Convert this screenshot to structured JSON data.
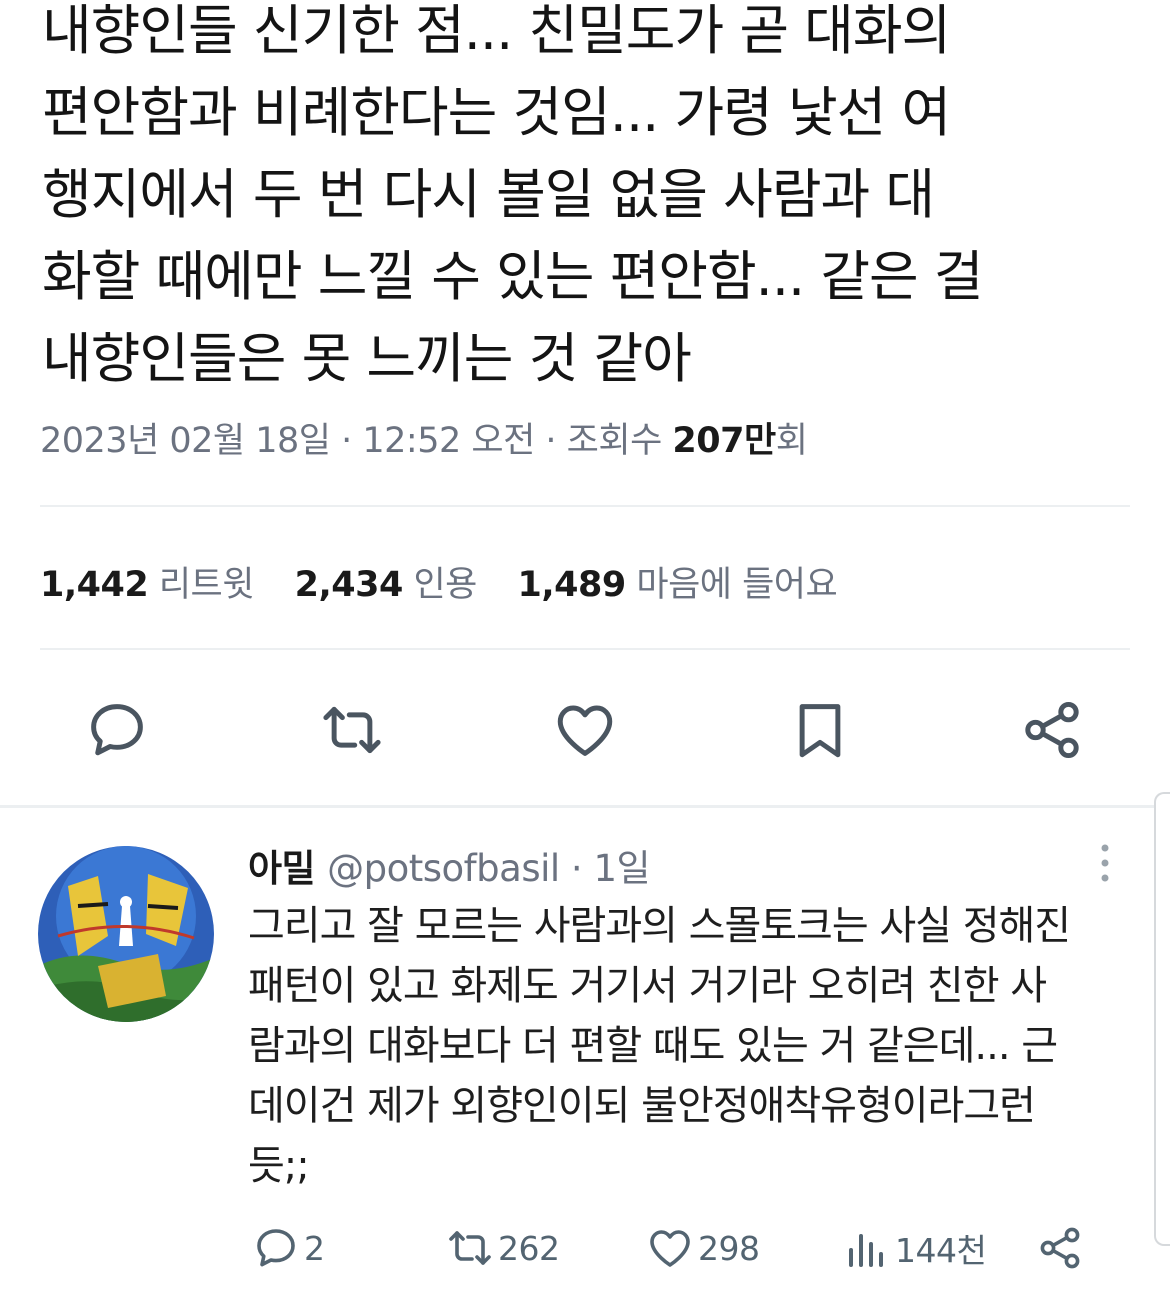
{
  "tweet": {
    "lines": [
      "내향인들 신기한 점... 친밀도가 곧 대화의",
      "편안함과 비례한다는 것임... 가령 낯선 여",
      "행지에서 두 번 다시 볼일 없을 사람과 대",
      "화할 때에만 느낄 수 있는 편안함... 같은 걸",
      "내향인들은 못 느끼는 것 같아"
    ],
    "meta": {
      "date": "2023년 02월 18일",
      "sep": " · ",
      "time": "12:52 오전",
      "views_label": "조회수",
      "views_num": "207만",
      "views_suffix": "회"
    },
    "stats": {
      "retweets_num": "1,442",
      "retweets_label": "리트윗",
      "quotes_num": "2,434",
      "quotes_label": "인용",
      "likes_num": "1,489",
      "likes_label": "마음에 들어요"
    },
    "actions": [
      {
        "icon": "reply-icon"
      },
      {
        "icon": "retweet-icon"
      },
      {
        "icon": "heart-icon"
      },
      {
        "icon": "bookmark-icon"
      },
      {
        "icon": "share-icon"
      }
    ]
  },
  "reply": {
    "name": "아밀",
    "handle": "@potsofbasil",
    "time": " · 1일",
    "lines": [
      "그리고 잘 모르는 사람과의 스몰토크는 사실 정해진",
      "패턴이 있고 화제도 거기서 거기라 오히려 친한 사",
      "람과의 대화보다 더 편할 때도 있는 거 같은데... 근",
      "데이건 제가 외향인이되 불안정애착유형이라그런",
      "듯;;"
    ],
    "counts": {
      "replies": "2",
      "retweets": "262",
      "likes": "298",
      "views": "144천"
    }
  },
  "colors": {
    "text": "#141414",
    "secondary": "#6b7280",
    "divider": "#eceff1",
    "icon": "#536471"
  }
}
